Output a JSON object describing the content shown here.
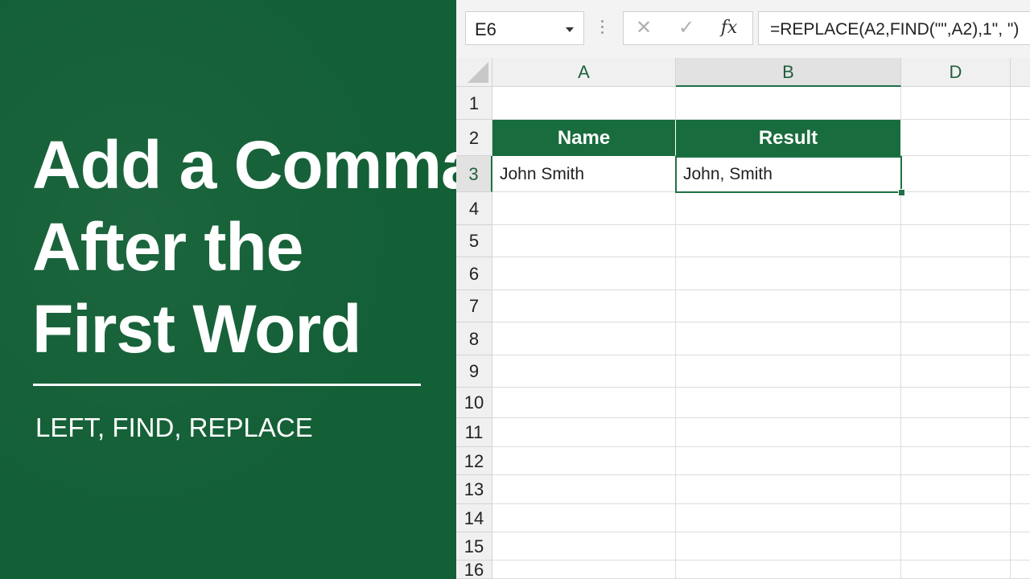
{
  "title_lines": [
    "Add a Comma",
    "After the",
    "First Word"
  ],
  "subtitle": "LEFT, FIND, REPLACE",
  "formula_bar": {
    "name_box": "E6",
    "cancel_icon": "✕",
    "enter_icon": "✓",
    "fx_label": "fx",
    "formula": "=REPLACE(A2,FIND(\"\",A2),1\", \")"
  },
  "columns": [
    "A",
    "B",
    "D"
  ],
  "rows": [
    "1",
    "2",
    "3",
    "4",
    "5",
    "6",
    "7",
    "8",
    "9",
    "10",
    "11",
    "12",
    "13",
    "14",
    "15",
    "16"
  ],
  "table": {
    "headers": [
      "Name",
      "Result"
    ],
    "data": [
      [
        "John Smith",
        "John, Smith"
      ]
    ]
  },
  "colors": {
    "panel_green": "#135f36",
    "header_green": "#196c3d",
    "selection_green": "#1e7145"
  },
  "active_cell": "B3"
}
